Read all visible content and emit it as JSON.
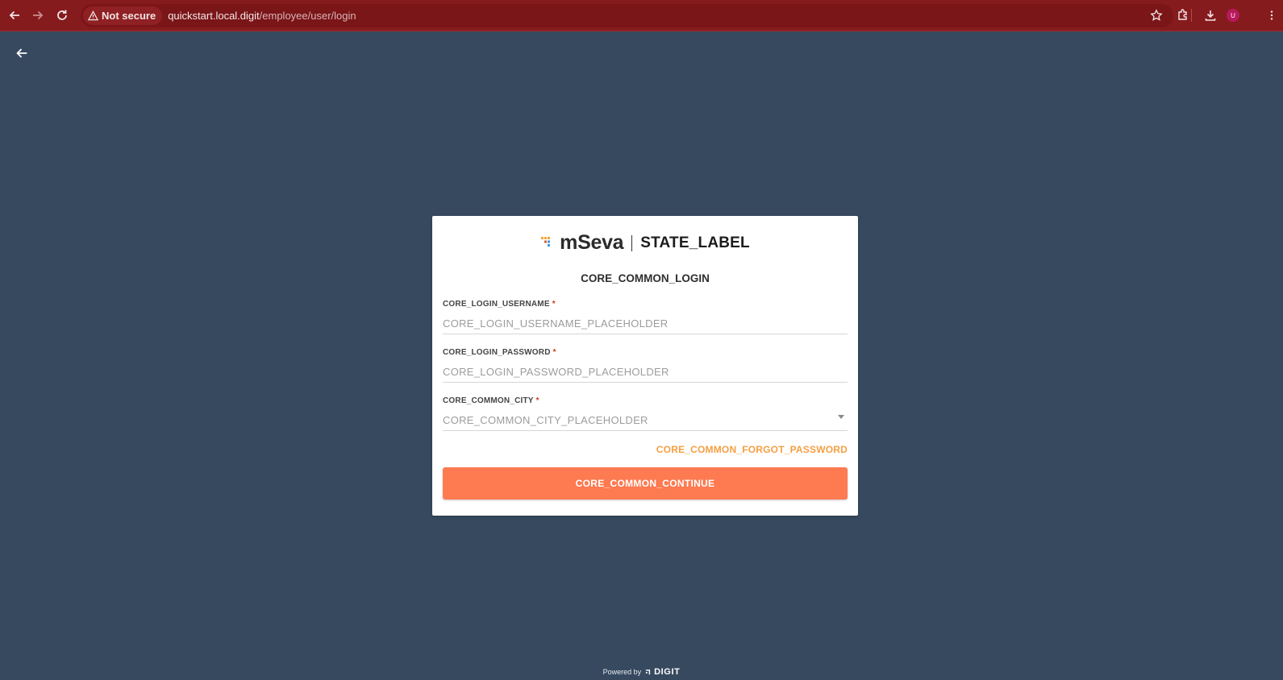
{
  "browser": {
    "security_label": "Not secure",
    "url_host": "quickstart.local.digit",
    "url_path": "/employee/user/login",
    "profile_initial": "U"
  },
  "brand": {
    "name": "mSeva",
    "state_label": "STATE_LABEL"
  },
  "login": {
    "title": "CORE_COMMON_LOGIN",
    "username_label": "CORE_LOGIN_USERNAME",
    "username_placeholder": "CORE_LOGIN_USERNAME_PLACEHOLDER",
    "password_label": "CORE_LOGIN_PASSWORD",
    "password_placeholder": "CORE_LOGIN_PASSWORD_PLACEHOLDER",
    "city_label": "CORE_COMMON_CITY",
    "city_placeholder": "CORE_COMMON_CITY_PLACEHOLDER",
    "required_marker": "*",
    "forgot_password": "CORE_COMMON_FORGOT_PASSWORD",
    "continue": "CORE_COMMON_CONTINUE"
  },
  "footer": {
    "powered_by": "Powered by",
    "digit": "DIGIT"
  },
  "colors": {
    "page_bg": "#36495f",
    "browser_bar": "#861b1e",
    "accent_button": "#fe7a51",
    "link": "#f59f42",
    "required": "#d4351c"
  },
  "icons": [
    "back-arrow-icon",
    "forward-arrow-icon",
    "reload-icon",
    "warning-icon",
    "star-icon",
    "extensions-icon",
    "download-icon",
    "menu-icon",
    "chevron-down-icon"
  ]
}
